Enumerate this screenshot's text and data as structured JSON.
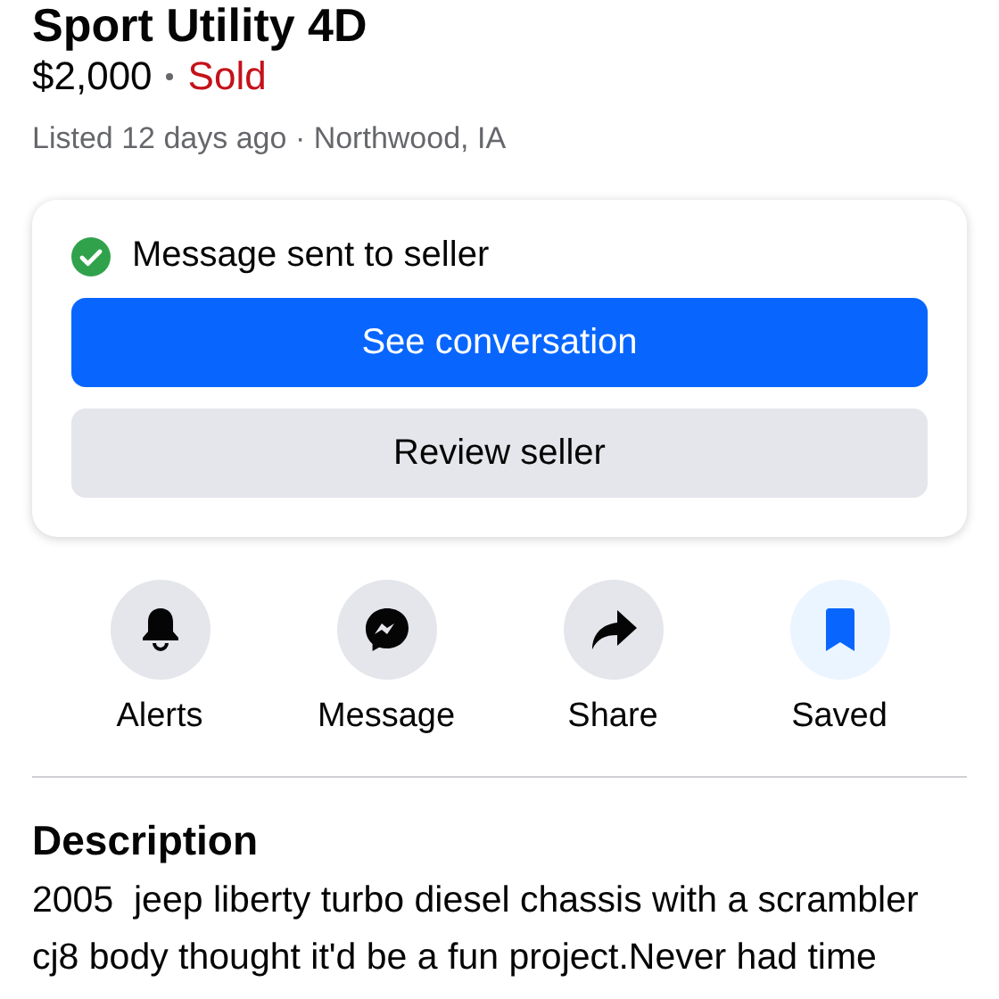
{
  "listing": {
    "title": "Sport Utility 4D",
    "price": "$2,000",
    "status": "Sold",
    "meta": "Listed 12 days ago · Northwood, IA"
  },
  "notice": {
    "text": "Message sent to seller",
    "primary_button": "See conversation",
    "secondary_button": "Review seller"
  },
  "actions": [
    {
      "kind": "bell",
      "label": "Alerts",
      "on": false
    },
    {
      "kind": "messenger",
      "label": "Message",
      "on": false
    },
    {
      "kind": "share",
      "label": "Share",
      "on": false
    },
    {
      "kind": "bookmark",
      "label": "Saved",
      "on": true
    }
  ],
  "description": {
    "heading": "Description",
    "text": "2005  jeep liberty turbo diesel chassis with a scrambler cj8 body thought it'd be a fun project.Never had time"
  }
}
